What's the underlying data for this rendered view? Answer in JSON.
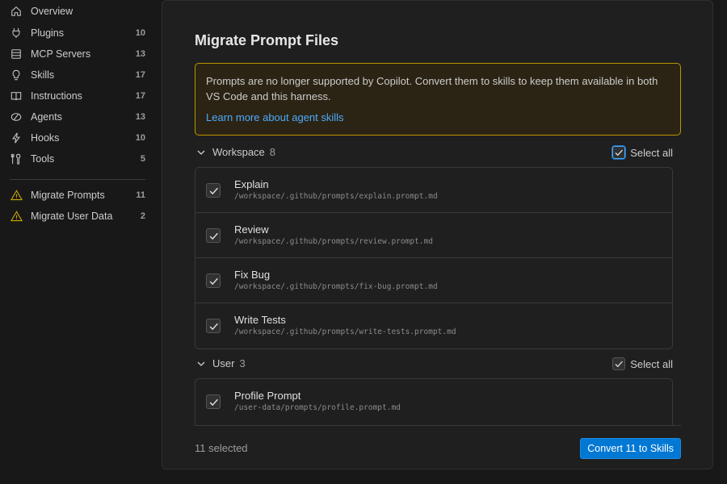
{
  "sidebar": {
    "items": [
      {
        "label": "Overview",
        "count": "",
        "icon": "home-icon"
      },
      {
        "label": "Plugins",
        "count": "10",
        "icon": "plug-icon"
      },
      {
        "label": "MCP Servers",
        "count": "13",
        "icon": "server-icon"
      },
      {
        "label": "Skills",
        "count": "17",
        "icon": "lightbulb-icon"
      },
      {
        "label": "Instructions",
        "count": "17",
        "icon": "book-icon"
      },
      {
        "label": "Agents",
        "count": "13",
        "icon": "agent-icon"
      },
      {
        "label": "Hooks",
        "count": "10",
        "icon": "lightning-icon"
      },
      {
        "label": "Tools",
        "count": "5",
        "icon": "tools-icon"
      }
    ],
    "migrate_items": [
      {
        "label": "Migrate Prompts",
        "count": "11",
        "icon": "warning-icon"
      },
      {
        "label": "Migrate User Data",
        "count": "2",
        "icon": "warning-icon"
      }
    ]
  },
  "main": {
    "title": "Migrate Prompt Files",
    "notice": {
      "text": "Prompts are no longer supported by Copilot. Convert them to skills to keep them available in both VS Code and this harness.",
      "link": "Learn more about agent skills",
      "border_color": "#b89500"
    },
    "groups": [
      {
        "name": "Workspace",
        "count": "8",
        "select_all": "Select all",
        "rows": [
          {
            "name": "Explain",
            "path": "/workspace/.github/prompts/explain.prompt.md"
          },
          {
            "name": "Review",
            "path": "/workspace/.github/prompts/review.prompt.md"
          },
          {
            "name": "Fix Bug",
            "path": "/workspace/.github/prompts/fix-bug.prompt.md"
          },
          {
            "name": "Write Tests",
            "path": "/workspace/.github/prompts/write-tests.prompt.md"
          }
        ]
      },
      {
        "name": "User",
        "count": "3",
        "select_all": "Select all",
        "rows": [
          {
            "name": "Profile Prompt",
            "path": "/user-data/prompts/profile.prompt.md"
          }
        ]
      }
    ],
    "footer": {
      "selected": "11 selected",
      "convert_label": "Convert 11 to Skills",
      "accent": "#0078d4"
    }
  }
}
